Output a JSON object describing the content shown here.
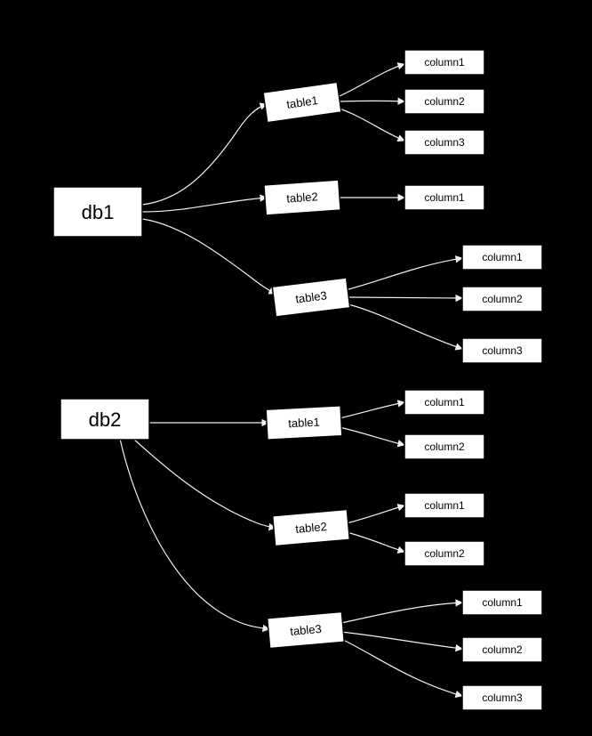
{
  "diagram": {
    "nodes": {
      "db1": "db1",
      "db2": "db2",
      "db1_table1": "table1",
      "db1_table2": "table2",
      "db1_table3": "table3",
      "db1_t1_c1": "column1",
      "db1_t1_c2": "column2",
      "db1_t1_c3": "column3",
      "db1_t2_c1": "column1",
      "db1_t3_c1": "column1",
      "db1_t3_c2": "column2",
      "db1_t3_c3": "column3",
      "db2_table1": "table1",
      "db2_table2": "table2",
      "db2_table3": "table3",
      "db2_t1_c1": "column1",
      "db2_t1_c2": "column2",
      "db2_t2_c1": "column1",
      "db2_t2_c2": "column2",
      "db2_t3_c1": "column1",
      "db2_t3_c2": "column2",
      "db2_t3_c3": "column3"
    },
    "structure": [
      {
        "id": "db1",
        "tables": [
          {
            "id": "table1",
            "columns": [
              "column1",
              "column2",
              "column3"
            ]
          },
          {
            "id": "table2",
            "columns": [
              "column1"
            ]
          },
          {
            "id": "table3",
            "columns": [
              "column1",
              "column2",
              "column3"
            ]
          }
        ]
      },
      {
        "id": "db2",
        "tables": [
          {
            "id": "table1",
            "columns": [
              "column1",
              "column2"
            ]
          },
          {
            "id": "table2",
            "columns": [
              "column1",
              "column2"
            ]
          },
          {
            "id": "table3",
            "columns": [
              "column1",
              "column2",
              "column3"
            ]
          }
        ]
      }
    ]
  }
}
